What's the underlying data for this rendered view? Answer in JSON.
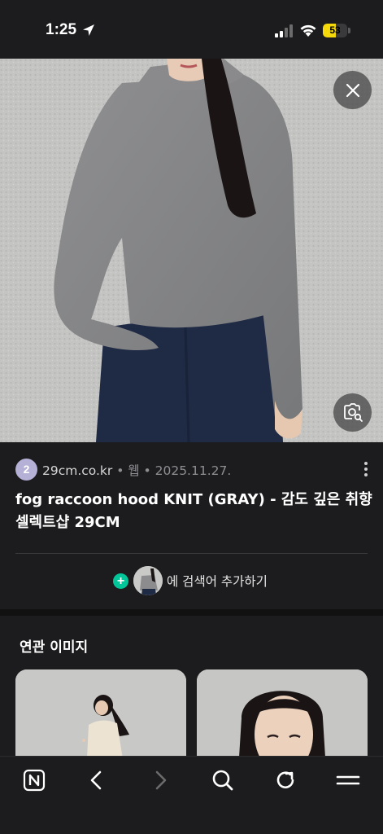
{
  "status_bar": {
    "time": "1:25",
    "battery": "53",
    "battery_level": 0.53,
    "battery_color": "#f5d90a"
  },
  "hero": {
    "close_icon": "close-icon",
    "lens_icon": "image-search-icon"
  },
  "result": {
    "favicon_letter": "2",
    "site": "29cm.co.kr",
    "type": "웹",
    "date": "2025.11.27.",
    "separator": "•",
    "title": "fog raccoon hood KNIT (GRAY) - 감도 깊은 취향 셀렉트샵 29CM",
    "add_search_label": "에 검색어 추가하기",
    "accent_color": "#03c59a"
  },
  "related": {
    "title": "연관 이미지"
  },
  "toolbar": {
    "items": [
      "naver-home-icon",
      "back-icon",
      "forward-icon",
      "search-icon",
      "refresh-icon",
      "menu-icon"
    ]
  }
}
